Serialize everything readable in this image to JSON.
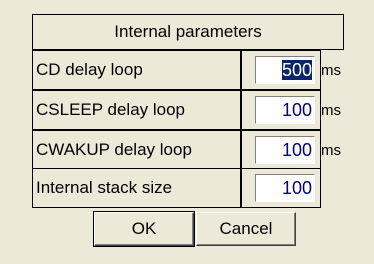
{
  "dialog": {
    "title": "Internal parameters",
    "rows": [
      {
        "label": "CD delay loop",
        "value": "500",
        "unit": "ms",
        "selected": true
      },
      {
        "label": "CSLEEP delay loop",
        "value": "100",
        "unit": "ms"
      },
      {
        "label": "CWAKUP delay loop",
        "value": "100",
        "unit": "ms"
      },
      {
        "label": "Internal stack size",
        "value": "100"
      }
    ],
    "buttons": {
      "ok": "OK",
      "cancel": "Cancel"
    }
  }
}
